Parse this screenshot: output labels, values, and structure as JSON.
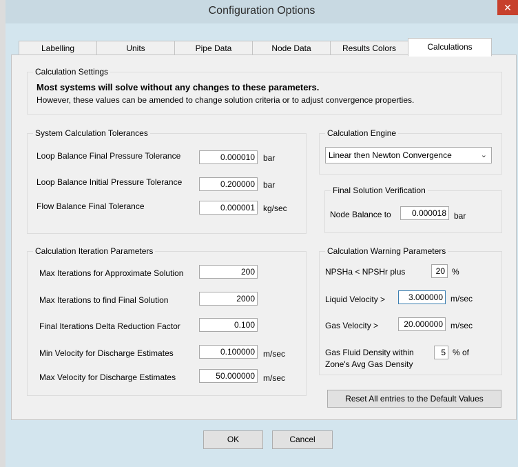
{
  "window": {
    "title": "Configuration Options",
    "close_label": "✕"
  },
  "tabs": [
    {
      "label": "Labelling"
    },
    {
      "label": "Units"
    },
    {
      "label": "Pipe Data"
    },
    {
      "label": "Node Data"
    },
    {
      "label": "Results Colors"
    },
    {
      "label": "Calculations",
      "active": true
    }
  ],
  "settings": {
    "group_label": "Calculation Settings",
    "bold_text": "Most systems will solve without any changes to these parameters.",
    "info_text": "However, these values can be amended to change solution criteria or to adjust convergence properties."
  },
  "tolerances": {
    "group_label": "System Calculation Tolerances",
    "rows": [
      {
        "label": "Loop Balance Final Pressure Tolerance",
        "value": "0.000010",
        "unit": "bar"
      },
      {
        "label": "Loop Balance Initial Pressure Tolerance",
        "value": "0.200000",
        "unit": "bar"
      },
      {
        "label": "Flow Balance Final Tolerance",
        "value": "0.000001",
        "unit": "kg/sec"
      }
    ]
  },
  "engine": {
    "group_label": "Calculation Engine",
    "selected": "Linear then Newton Convergence"
  },
  "verification": {
    "group_label": "Final Solution Verification",
    "label": "Node Balance to",
    "value": "0.000018",
    "unit": "bar"
  },
  "iteration": {
    "group_label": "Calculation Iteration Parameters",
    "rows": [
      {
        "label": "Max Iterations for Approximate Solution",
        "value": "200",
        "unit": ""
      },
      {
        "label": "Max Iterations to find Final Solution",
        "value": "2000",
        "unit": ""
      },
      {
        "label": "Final Iterations Delta Reduction Factor",
        "value": "0.100",
        "unit": ""
      },
      {
        "label": "Min Velocity for Discharge Estimates",
        "value": "0.100000",
        "unit": "m/sec"
      },
      {
        "label": "Max Velocity for Discharge Estimates",
        "value": "50.000000",
        "unit": "m/sec"
      }
    ]
  },
  "warning": {
    "group_label": "Calculation Warning Parameters",
    "npsh_label": "NPSHa  <  NPSHr plus",
    "npsh_value": "20",
    "npsh_unit": "%",
    "liquid_label": "Liquid Velocity >",
    "liquid_value": "3.000000",
    "liquid_unit": "m/sec",
    "gas_label": "Gas Velocity >",
    "gas_value": "20.000000",
    "gas_unit": "m/sec",
    "density_label_1": "Gas Fluid Density within",
    "density_label_2": "Zone's Avg Gas Density",
    "density_value": "5",
    "density_unit": "% of"
  },
  "reset_button": "Reset All entries to the Default Values",
  "ok_button": "OK",
  "cancel_button": "Cancel"
}
